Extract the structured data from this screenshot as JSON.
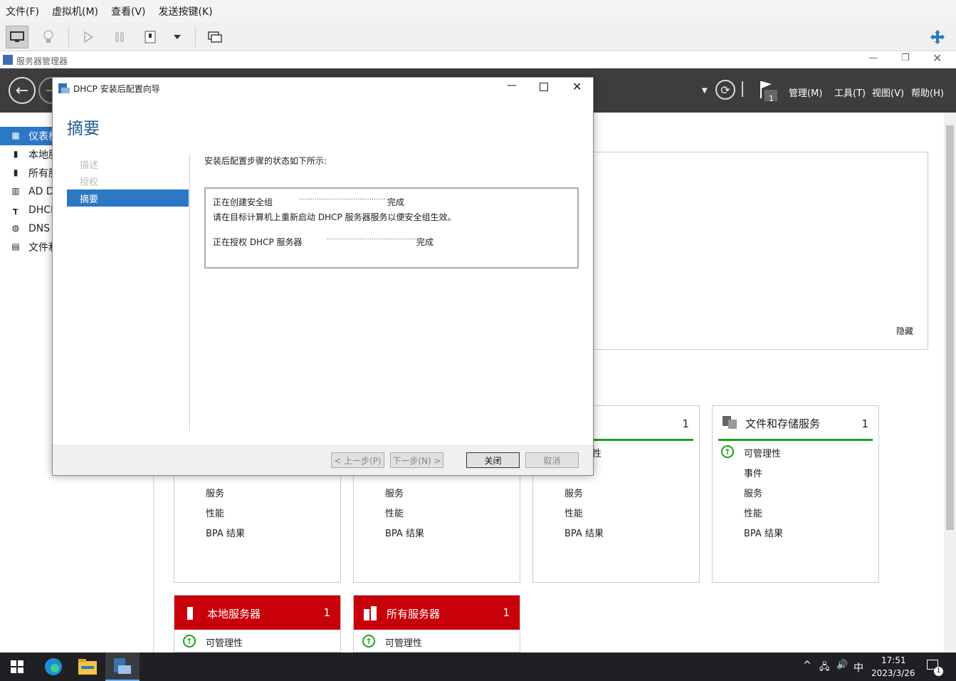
{
  "vm_menu": {
    "file": "文件(F)",
    "vm": "虚拟机(M)",
    "view": "查看(V)",
    "send_keys": "发送按键(K)"
  },
  "sm": {
    "window_title": "服务器管理器",
    "header_menu": {
      "manage": "管理(M)",
      "tools": "工具(T)",
      "view": "视图(V)",
      "help": "帮助(H)"
    },
    "flag_count": "1",
    "sidebar": [
      {
        "label": "仪表板"
      },
      {
        "label": "本地服务器"
      },
      {
        "label": "所有服务器"
      },
      {
        "label": "AD DS"
      },
      {
        "label": "DHCP"
      },
      {
        "label": "DNS"
      },
      {
        "label": "文件和存储服务"
      }
    ],
    "hide": "隐藏",
    "tiles": {
      "t3": {
        "count": "1",
        "r1": "可管理性",
        "r3": "服务",
        "r4": "性能",
        "r5": "BPA 结果"
      },
      "t4": {
        "title": "文件和存储服务",
        "count": "1",
        "r1": "可管理性",
        "r2": "事件",
        "r3": "服务",
        "r4": "性能",
        "r5": "BPA 结果"
      },
      "t1": {
        "r3": "服务",
        "r4": "性能",
        "r5": "BPA 结果"
      },
      "t2": {
        "r3": "服务",
        "r4": "性能",
        "r5": "BPA 结果"
      },
      "local": {
        "title": "本地服务器",
        "count": "1",
        "r1": "可管理性"
      },
      "all": {
        "title": "所有服务器",
        "count": "1",
        "r1": "可管理性"
      }
    }
  },
  "dialog": {
    "title": "DHCP 安装后配置向导",
    "heading": "摘要",
    "steps": [
      {
        "label": "描述"
      },
      {
        "label": "授权"
      },
      {
        "label": "摘要"
      }
    ],
    "intro": "安装后配置步骤的状态如下所示:",
    "line1_task": "正在创建安全组",
    "line1_dots": "..............................................",
    "line1_status": "完成",
    "line1_note": "请在目标计算机上重新启动 DHCP 服务器服务以便安全组生效。",
    "line2_task": "正在授权 DHCP 服务器",
    "line2_dots": "..............................................",
    "line2_status": "完成",
    "btn_prev": "< 上一步(P)",
    "btn_next": "下一步(N) >",
    "btn_close": "关闭",
    "btn_cancel": "取消"
  },
  "taskbar": {
    "ime": "中",
    "time": "17:51",
    "date": "2023/3/26",
    "notif": "1"
  }
}
